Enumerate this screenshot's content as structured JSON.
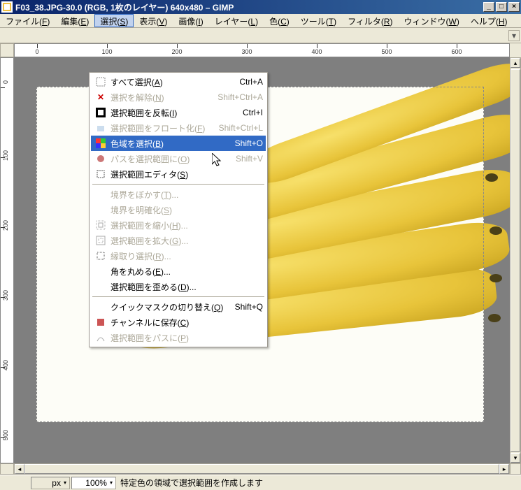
{
  "window": {
    "title": "F03_38.JPG-30.0 (RGB, 1枚のレイヤー) 640x480 – GIMP",
    "min": "_",
    "max": "□",
    "close": "×"
  },
  "menubar": [
    {
      "label": "ファイル",
      "mn": "F"
    },
    {
      "label": "編集",
      "mn": "E"
    },
    {
      "label": "選択",
      "mn": "S"
    },
    {
      "label": "表示",
      "mn": "V"
    },
    {
      "label": "画像",
      "mn": "I"
    },
    {
      "label": "レイヤー",
      "mn": "L"
    },
    {
      "label": "色",
      "mn": "C"
    },
    {
      "label": "ツール",
      "mn": "T"
    },
    {
      "label": "フィルタ",
      "mn": "R"
    },
    {
      "label": "ウィンドウ",
      "mn": "W"
    },
    {
      "label": "ヘルプ",
      "mn": "H"
    }
  ],
  "select_menu": [
    {
      "type": "item",
      "icon": "select-all",
      "label": "すべて選択",
      "mn": "A",
      "accel": "Ctrl+A",
      "enabled": true
    },
    {
      "type": "item",
      "icon": "x",
      "label": "選択を解除",
      "mn": "N",
      "accel": "Shift+Ctrl+A",
      "enabled": false
    },
    {
      "type": "item",
      "icon": "invert",
      "label": "選択範囲を反転",
      "mn": "I",
      "accel": "Ctrl+I",
      "enabled": true
    },
    {
      "type": "item",
      "icon": "float",
      "label": "選択範囲をフロート化",
      "mn": "F",
      "accel": "Shift+Ctrl+L",
      "enabled": false
    },
    {
      "type": "item",
      "icon": "color",
      "label": "色域を選択",
      "mn": "B",
      "accel": "Shift+O",
      "enabled": true,
      "hover": true
    },
    {
      "type": "item",
      "icon": "path",
      "label": "パスを選択範囲に",
      "mn": "O",
      "accel": "Shift+V",
      "enabled": false
    },
    {
      "type": "item",
      "icon": "editor",
      "label": "選択範囲エディタ",
      "mn": "S",
      "accel": "",
      "enabled": true
    },
    {
      "type": "sep"
    },
    {
      "type": "item",
      "icon": "",
      "label": "境界をぼかす",
      "mn": "T",
      "suffix": "...",
      "accel": "",
      "enabled": false
    },
    {
      "type": "item",
      "icon": "",
      "label": "境界を明確化",
      "mn": "S",
      "accel": "",
      "enabled": false
    },
    {
      "type": "item",
      "icon": "shrink",
      "label": "選択範囲を縮小",
      "mn": "H",
      "suffix": "...",
      "accel": "",
      "enabled": false
    },
    {
      "type": "item",
      "icon": "grow",
      "label": "選択範囲を拡大",
      "mn": "G",
      "suffix": "...",
      "accel": "",
      "enabled": false
    },
    {
      "type": "item",
      "icon": "border",
      "label": "縁取り選択",
      "mn": "R",
      "suffix": "...",
      "accel": "",
      "enabled": false
    },
    {
      "type": "item",
      "icon": "",
      "label": "角を丸める",
      "mn": "E",
      "suffix": "...",
      "accel": "",
      "enabled": true
    },
    {
      "type": "item",
      "icon": "",
      "label": "選択範囲を歪める",
      "mn": "D",
      "suffix": "...",
      "accel": "",
      "enabled": true
    },
    {
      "type": "sep"
    },
    {
      "type": "item",
      "icon": "",
      "label": "クイックマスクの切り替え",
      "mn": "Q",
      "accel": "Shift+Q",
      "enabled": true
    },
    {
      "type": "item",
      "icon": "channel",
      "label": "チャンネルに保存",
      "mn": "C",
      "accel": "",
      "enabled": true
    },
    {
      "type": "item",
      "icon": "topath",
      "label": "選択範囲をパスに",
      "mn": "P",
      "accel": "",
      "enabled": false
    }
  ],
  "ruler_h_ticks": [
    0,
    100,
    200,
    300,
    400,
    500,
    600
  ],
  "ruler_v_ticks": [
    0,
    100,
    200,
    300,
    400,
    500
  ],
  "status": {
    "unit": "px",
    "zoom": "100%",
    "message": "特定色の領域で選択範囲を作成します"
  }
}
